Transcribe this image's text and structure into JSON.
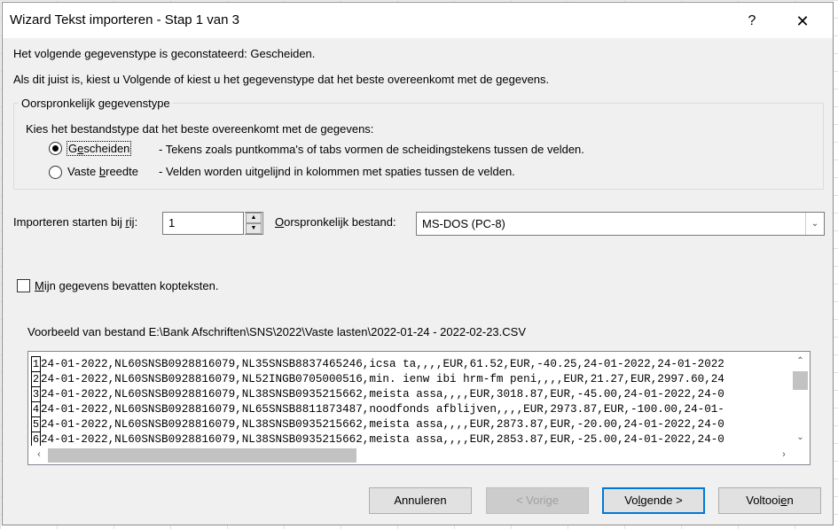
{
  "window": {
    "title": "Wizard Tekst importeren - Stap 1 van 3",
    "help": "?",
    "close": "✕"
  },
  "intro": {
    "line1": "Het volgende gegevenstype is geconstateerd: Gescheiden.",
    "line2": "Als dit juist is, kiest u Volgende of kiest u het gegevenstype dat het beste overeenkomt met de gegevens."
  },
  "original_type": {
    "legend": "Oorspronkelijk gegevenstype",
    "prompt": "Kies het bestandstype dat het beste overeenkomt met de gegevens:",
    "options": [
      {
        "label_pre": "G",
        "label_u": "e",
        "label_post": "scheiden",
        "desc": "- Tekens zoals puntkomma's of tabs vormen de scheidingstekens tussen de velden.",
        "checked": true
      },
      {
        "label_pre": "Vaste ",
        "label_u": "b",
        "label_post": "reedte",
        "desc": "- Velden worden uitgelijnd in kolommen met spaties tussen de velden.",
        "checked": false
      }
    ]
  },
  "start_row": {
    "label_pre": "Importeren starten bij ",
    "label_u": "r",
    "label_post": "ij:",
    "value": "1",
    "up": "▲",
    "down": "▼"
  },
  "origin": {
    "label_u": "O",
    "label_post": "orspronkelijk bestand:",
    "value": "MS-DOS (PC-8)",
    "arrow": "⌄"
  },
  "headers_checkbox": {
    "label_u": "M",
    "label_post": "ijn gegevens bevatten kopteksten.",
    "checked": false
  },
  "preview": {
    "caption": "Voorbeeld van bestand E:\\Bank Afschriften\\SNS\\2022\\Vaste lasten\\2022-01-24 - 2022-02-23.CSV",
    "rows": [
      {
        "num": "1",
        "text": "24-01-2022,NL60SNSB0928816079,NL35SNSB8837465246,icsa ta,,,,EUR,61.52,EUR,-40.25,24-01-2022,24-01-2022"
      },
      {
        "num": "2",
        "text": "24-01-2022,NL60SNSB0928816079,NL52INGB0705000516,min. ienw ibi hrm-fm peni,,,,EUR,21.27,EUR,2997.60,24"
      },
      {
        "num": "3",
        "text": "24-01-2022,NL60SNSB0928816079,NL38SNSB0935215662,meista assa,,,,EUR,3018.87,EUR,-45.00,24-01-2022,24-0"
      },
      {
        "num": "4",
        "text": "24-01-2022,NL60SNSB0928816079,NL65SNSB8811873487,noodfonds afblijven,,,,EUR,2973.87,EUR,-100.00,24-01-"
      },
      {
        "num": "5",
        "text": "24-01-2022,NL60SNSB0928816079,NL38SNSB0935215662,meista assa,,,,EUR,2873.87,EUR,-20.00,24-01-2022,24-0"
      },
      {
        "num": "6",
        "text": "24-01-2022,NL60SNSB0928816079,NL38SNSB0935215662,meista assa,,,,EUR,2853.87,EUR,-25.00,24-01-2022,24-0"
      }
    ],
    "scroll_up": "⌃",
    "scroll_down": "⌄",
    "scroll_left": "‹",
    "scroll_right": "›"
  },
  "buttons": {
    "cancel": "Annuleren",
    "back": "< Vorige",
    "next_pre": "Vo",
    "next_u": "l",
    "next_post": "gende >",
    "finish_pre": "Voltooi",
    "finish_u": "e",
    "finish_post": "n"
  }
}
